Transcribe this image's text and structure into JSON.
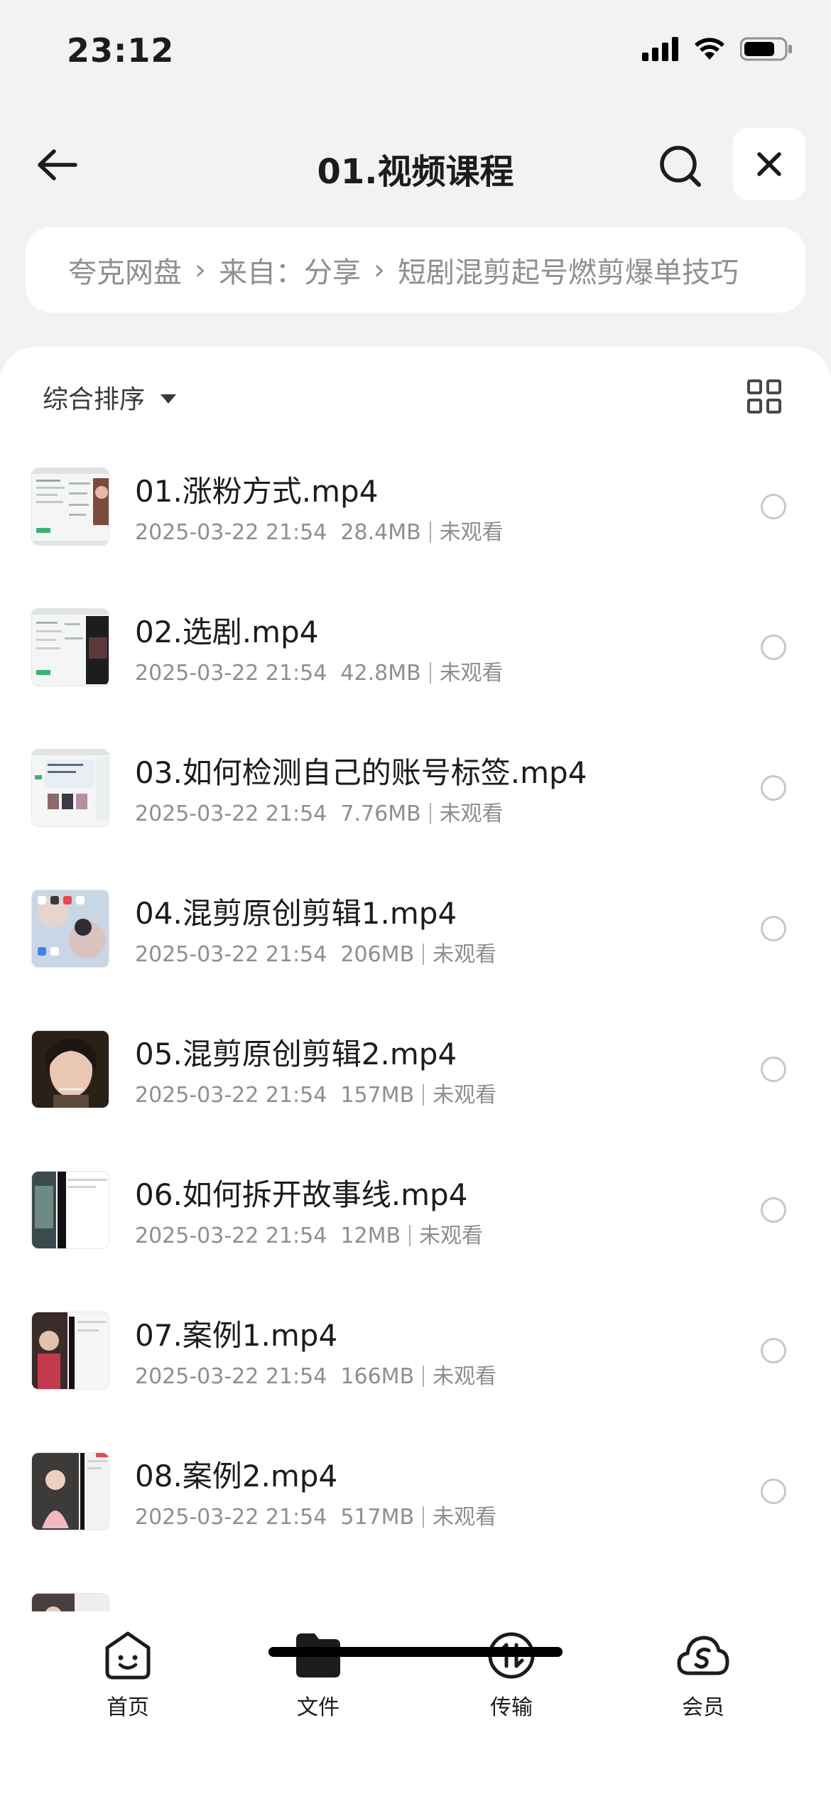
{
  "status": {
    "time": "23:12"
  },
  "nav": {
    "title": "01.视频课程"
  },
  "breadcrumb": [
    "夸克网盘",
    "来自：分享",
    "短剧混剪起号燃剪爆单技巧"
  ],
  "sort": {
    "label": "综合排序"
  },
  "files": [
    {
      "name": "01.涨粉方式.mp4",
      "date": "2025-03-22 21:54",
      "size": "28.4MB",
      "status": "未观看",
      "thumb": "screen"
    },
    {
      "name": "02.选剧.mp4",
      "date": "2025-03-22 21:54",
      "size": "42.8MB",
      "status": "未观看",
      "thumb": "screen-dark"
    },
    {
      "name": "03.如何检测自己的账号标签.mp4",
      "date": "2025-03-22 21:54",
      "size": "7.76MB",
      "status": "未观看",
      "thumb": "screen-grid"
    },
    {
      "name": "04.混剪原创剪辑1.mp4",
      "date": "2025-03-22 21:54",
      "size": "206MB",
      "status": "未观看",
      "thumb": "phone"
    },
    {
      "name": "05.混剪原创剪辑2.mp4",
      "date": "2025-03-22 21:54",
      "size": "157MB",
      "status": "未观看",
      "thumb": "face"
    },
    {
      "name": "06.如何拆开故事线.mp4",
      "date": "2025-03-22 21:54",
      "size": "12MB",
      "status": "未观看",
      "thumb": "split"
    },
    {
      "name": "07.案例1.mp4",
      "date": "2025-03-22 21:54",
      "size": "166MB",
      "status": "未观看",
      "thumb": "person-screen"
    },
    {
      "name": "08.案例2.mp4",
      "date": "2025-03-22 21:54",
      "size": "517MB",
      "status": "未观看",
      "thumb": "pink"
    }
  ],
  "tabs": [
    {
      "label": "首页",
      "icon": "home-face-icon"
    },
    {
      "label": "文件",
      "icon": "folder-icon"
    },
    {
      "label": "传输",
      "icon": "transfer-icon"
    },
    {
      "label": "会员",
      "icon": "vip-cloud-icon"
    }
  ]
}
